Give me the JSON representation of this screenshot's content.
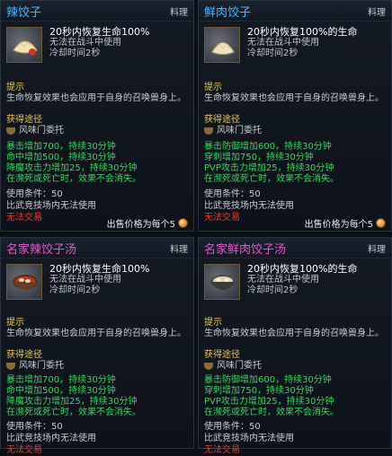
{
  "cards": [
    {
      "title": "辣饺子",
      "category": "料理",
      "effect": "20秒内恢复生命100%",
      "no_combat": "无法在战斗中使用",
      "cooldown": "冷却时间2秒",
      "hint_label": "提示",
      "hint_text": "生命恢复效果也会应用于自身的召唤兽身上。",
      "source_label": "获得途径",
      "source": "风味门委托",
      "buffs": [
        "暴击增加700，持续30分钟",
        "命中增加500，持续30分钟",
        "降魔攻击力增加25，持续30分钟",
        "在濒死或死亡时，效果不会消失。"
      ],
      "use_cond": "使用条件：50",
      "arena": "比武竞技场内无法使用",
      "trade": "无法交易",
      "price": "出售价格为每个5"
    },
    {
      "title": "鲜肉饺子",
      "category": "料理",
      "effect": "20秒内恢复100%的生命",
      "no_combat": "无法在战斗中使用",
      "cooldown": "冷却时间2秒",
      "hint_label": "提示",
      "hint_text": "生命恢复效果也会应用于自身的召唤兽身上。",
      "source_label": "获得途径",
      "source": "风味门委托",
      "buffs": [
        "暴击防御增加600，持续30分钟",
        "穿刺增加750，持续30分钟",
        "PVP攻击力增加25，持续30分钟",
        "在濒死或死亡时，效果不会消失。"
      ],
      "use_cond": "使用条件：50",
      "arena": "比武竞技场内无法使用",
      "trade": "无法交易",
      "price": "出售价格为每个5"
    },
    {
      "title": "名家辣饺子汤",
      "category": "料理",
      "effect": "20秒内恢复生命100%",
      "no_combat": "无法在战斗中使用",
      "cooldown": "冷却时间2秒",
      "hint_label": "提示",
      "hint_text": "生命恢复效果也会应用于自身的召唤兽身上。",
      "source_label": "获得途径",
      "source": "风味门委托",
      "buffs": [
        "暴击增加700，持续30分钟",
        "命中增加500，持续30分钟",
        "降魔攻击力增加25，持续30分钟",
        "在濒死或死亡时，效果不会消失。"
      ],
      "use_cond": "使用条件：50",
      "arena": "比武竞技场内无法使用",
      "trade": "无法交易",
      "price": ""
    },
    {
      "title": "名家鲜肉饺子汤",
      "category": "料理",
      "effect": "20秒内恢复100%的生命",
      "no_combat": "无法在战斗中使用",
      "cooldown": "冷却时间2秒",
      "hint_label": "提示",
      "hint_text": "生命恢复效果也会应用于自身的召唤兽身上。",
      "source_label": "获得途径",
      "source": "风味门委托",
      "buffs": [
        "暴击防御增加600，持续30分钟",
        "穿刺增加750，持续30分钟",
        "PVP攻击力增加25，持续30分钟",
        "在濒死或死亡时，效果不会消失。"
      ],
      "use_cond": "使用条件：50",
      "arena": "比武竞技场内无法使用",
      "trade": "无法交易",
      "price": ""
    }
  ],
  "colors": {
    "title_blue": "#43b6ff",
    "title_pink": "#e557c9",
    "buff_green": "#2fda5a",
    "label_yellow": "#e7c84f",
    "trade_red": "#e23c36"
  },
  "icons": [
    "dumpling-icon",
    "bowl-icon",
    "coin-icon"
  ]
}
